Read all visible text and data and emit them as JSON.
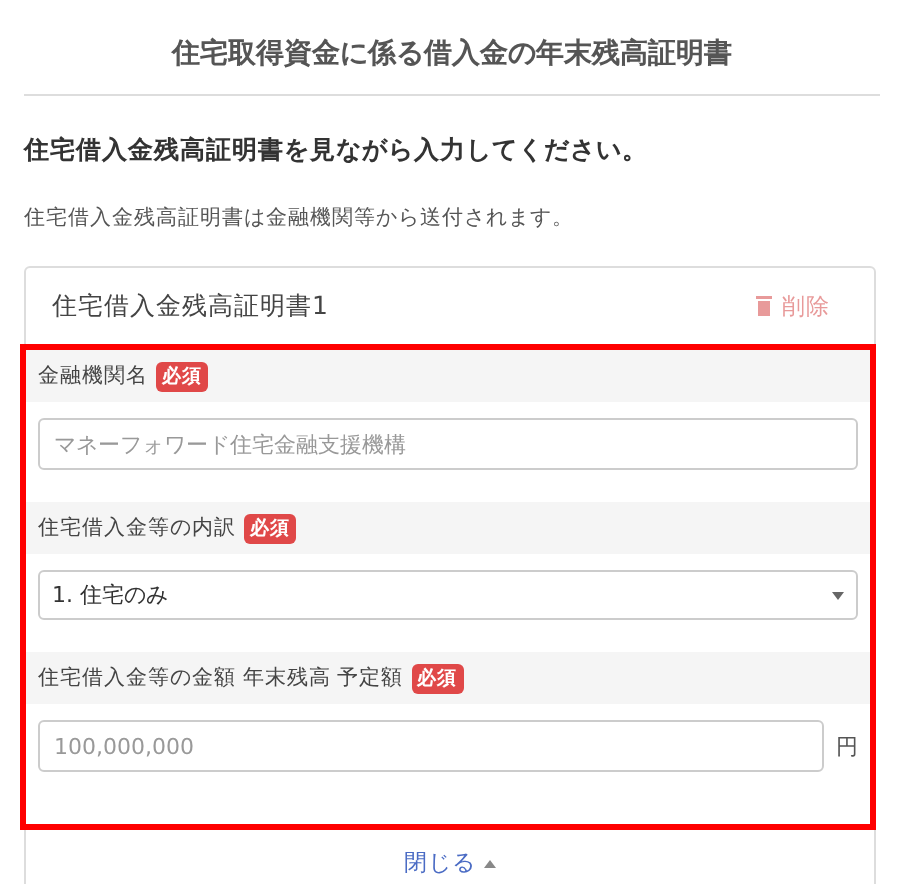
{
  "title": "住宅取得資金に係る借入金の年末残高証明書",
  "instruction": "住宅借入金残高証明書を見ながら入力してください。",
  "note": "住宅借入金残高証明書は金融機関等から送付されます。",
  "card": {
    "title": "住宅借入金残高証明書1",
    "delete_label": "削除",
    "fields": [
      {
        "kind": "text",
        "label": "金融機関名",
        "required": true,
        "badge": "必須",
        "placeholder": "マネーフォワード住宅金融支援機構"
      },
      {
        "kind": "select",
        "label": "住宅借入金等の内訳",
        "required": true,
        "badge": "必須",
        "value": "1. 住宅のみ"
      },
      {
        "kind": "amount",
        "label": "住宅借入金等の金額 年末残高 予定額",
        "required": true,
        "badge": "必須",
        "placeholder": "100,000,000",
        "unit": "円"
      }
    ],
    "close_label": "閉じる"
  }
}
